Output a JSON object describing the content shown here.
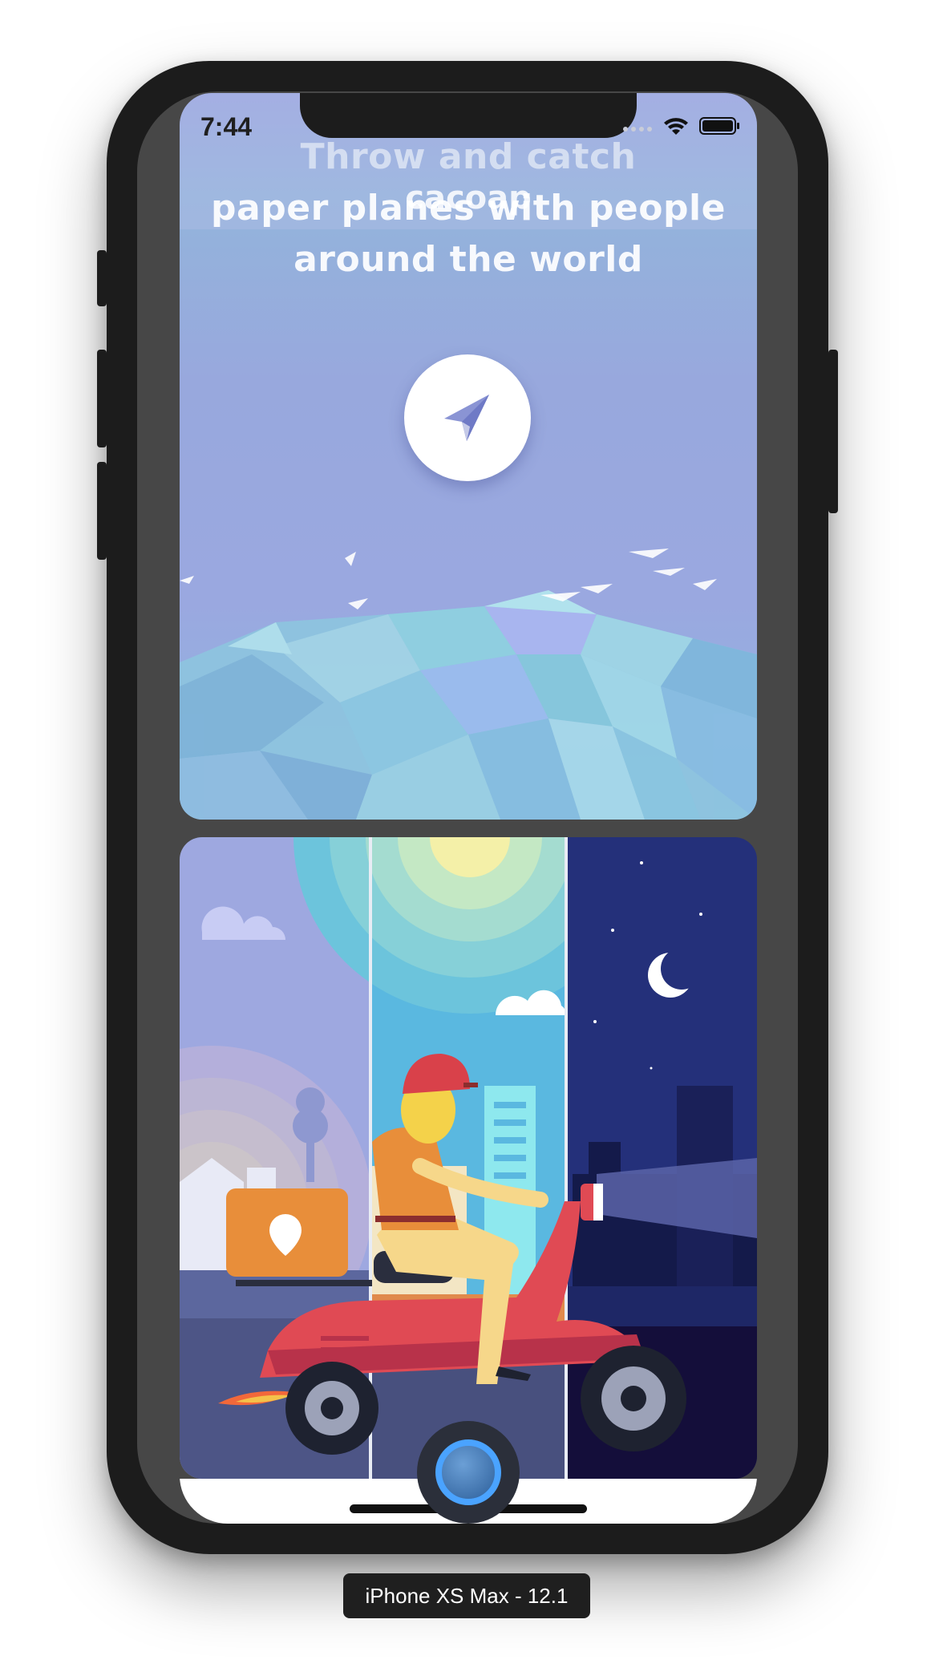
{
  "status_bar": {
    "time": "7:44"
  },
  "app": {
    "headline_lines": [
      "Throw and catch",
      "paper planes with people",
      "around the world"
    ],
    "overlay_title": "cacoap"
  },
  "device_label": "iPhone XS Max - 12.1",
  "colors": {
    "card_bg": "#9aa8e0",
    "accent_plane": "#8a94d4",
    "fab_ring": "#4aa3ff"
  },
  "icons": {
    "plane_button": "paper-plane-icon",
    "wifi": "wifi-icon",
    "battery": "battery-icon",
    "signal": "cellular-signal-icon"
  }
}
